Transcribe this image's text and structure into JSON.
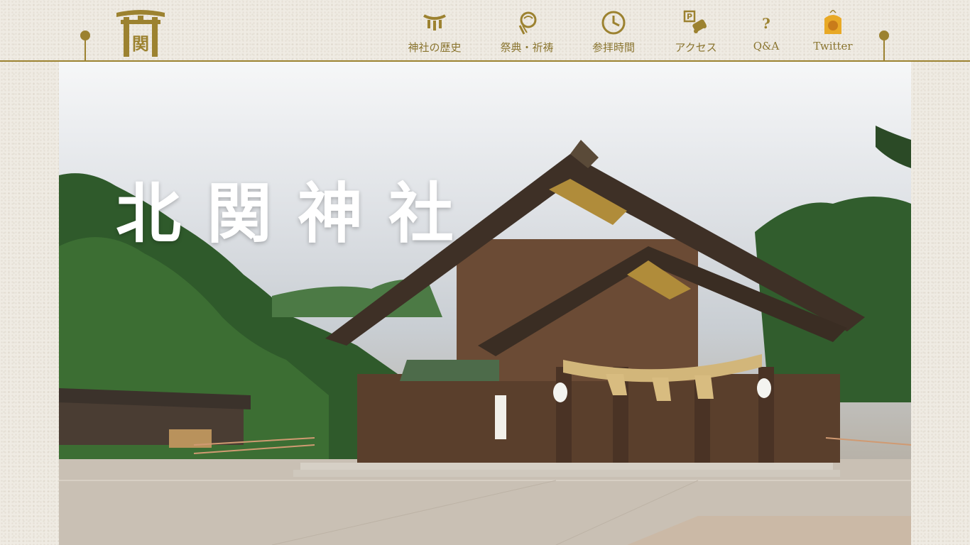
{
  "site": {
    "logo_icon": "torii-gate-logo",
    "logo_glyph": "関"
  },
  "nav": {
    "items": [
      {
        "label": "神社の歴史",
        "icon": "shimenawa-icon"
      },
      {
        "label": "祭典・祈祷",
        "icon": "prayer-icon"
      },
      {
        "label": "参拝時間",
        "icon": "clock-icon"
      },
      {
        "label": "アクセス",
        "icon": "parking-access-icon"
      },
      {
        "label": "Q&A",
        "icon": "question-icon"
      },
      {
        "label": "Twitter",
        "icon": "twitter-omamori-icon"
      }
    ]
  },
  "hero": {
    "title": "北関神社"
  },
  "colors": {
    "accent": "#9c8230",
    "nav_text": "#8a7530",
    "background": "#efebe3",
    "title_text": "#ffffff"
  }
}
